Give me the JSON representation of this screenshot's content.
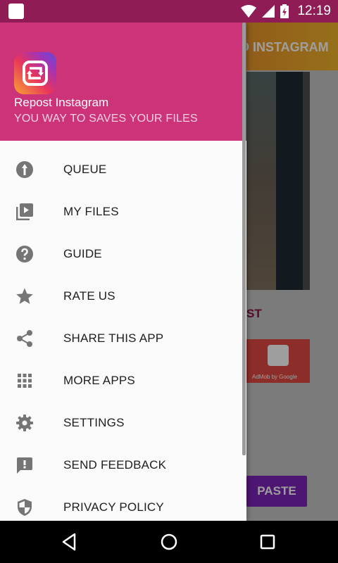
{
  "status_bar": {
    "time": "12:19"
  },
  "background_app": {
    "toolbar_title": "O INSTAGRAM",
    "post_label": "ST",
    "ad_text": "AdMob by Google",
    "paste_label": "PASTE"
  },
  "drawer": {
    "app_name": "Repost Instagram",
    "tagline": "YOU WAY TO SAVES YOUR FILES",
    "items": [
      {
        "label": "QUEUE",
        "icon": "queue-icon"
      },
      {
        "label": "MY FILES",
        "icon": "video-library-icon"
      },
      {
        "label": "GUIDE",
        "icon": "help-icon"
      },
      {
        "label": "RATE US",
        "icon": "star-icon"
      },
      {
        "label": "SHARE THIS APP",
        "icon": "share-icon"
      },
      {
        "label": "MORE APPS",
        "icon": "apps-grid-icon"
      },
      {
        "label": "SETTINGS",
        "icon": "gear-icon"
      },
      {
        "label": "SEND FEEDBACK",
        "icon": "feedback-icon"
      },
      {
        "label": "PRIVACY POLICY",
        "icon": "shield-icon"
      }
    ]
  },
  "colors": {
    "status_bar": "#8f1c55",
    "drawer_header": "#cc3378",
    "icon_gray": "#757575"
  }
}
